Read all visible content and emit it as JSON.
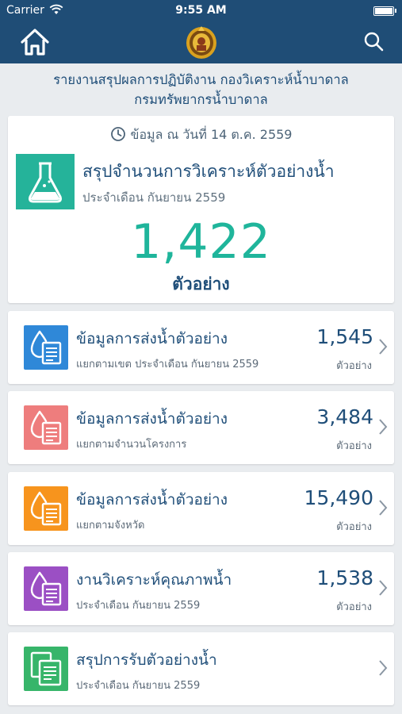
{
  "status_bar": {
    "carrier": "Carrier",
    "time": "9:55 AM"
  },
  "navbar": {
    "home_icon": "home-icon",
    "logo_icon": "emblem-logo",
    "search_icon": "search-icon"
  },
  "header": {
    "line1": "รายงานสรุปผลการปฏิบัติงาน กองวิเคราะห์น้ำบาดาล",
    "line2": "กรมทรัพยากรน้ำบาดาล"
  },
  "summary": {
    "date_text": "ข้อมูล ณ วันที่ 14 ต.ค. 2559",
    "title": "สรุปจำนวนการวิเคราะห์ตัวอย่างน้ำ",
    "period": "ประจำเดือน กันยายน 2559",
    "value": "1,422",
    "unit": "ตัวอย่าง",
    "icon_color": "#25b39a"
  },
  "items": [
    {
      "title": "ข้อมูลการส่งน้ำตัวอย่าง",
      "subtitle": "แยกตามเขต ประจำเดือน กันยายน 2559",
      "value": "1,545",
      "unit": "ตัวอย่าง",
      "color": "#2f88d8",
      "icon": "water-drop-document-icon"
    },
    {
      "title": "ข้อมูลการส่งน้ำตัวอย่าง",
      "subtitle": "แยกตามจำนวนโครงการ",
      "value": "3,484",
      "unit": "ตัวอย่าง",
      "color": "#ee7d7d",
      "icon": "water-drop-document-icon"
    },
    {
      "title": "ข้อมูลการส่งน้ำตัวอย่าง",
      "subtitle": "แยกตามจังหวัด",
      "value": "15,490",
      "unit": "ตัวอย่าง",
      "color": "#f7941d",
      "icon": "water-drop-document-icon"
    },
    {
      "title": "งานวิเคราะห์คุณภาพน้ำ",
      "subtitle": "ประจำเดือน กันยายน 2559",
      "value": "1,538",
      "unit": "ตัวอย่าง",
      "color": "#9b4fc4",
      "icon": "water-drop-document-icon"
    },
    {
      "title": "สรุปการรับตัวอย่างน้ำ",
      "subtitle": "ประจำเดือน กันยายน 2559",
      "value": "",
      "unit": "",
      "color": "#37b56a",
      "icon": "documents-icon"
    }
  ]
}
